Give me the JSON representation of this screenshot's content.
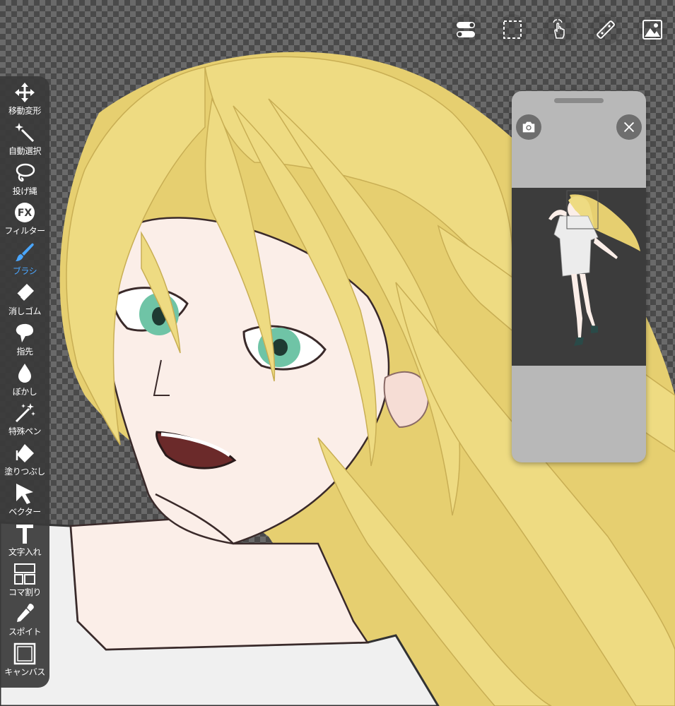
{
  "colors": {
    "accent": "#4aa6ff",
    "palette_bg": "#3a3a3a",
    "hair": "#ead67a",
    "skin": "#fbeee8",
    "eye": "#6fc4a6"
  },
  "top_toolbar": [
    {
      "id": "toggle",
      "icon": "toggle-switch-icon"
    },
    {
      "id": "selection",
      "icon": "dashed-selection-icon"
    },
    {
      "id": "touch",
      "icon": "touch-gesture-icon"
    },
    {
      "id": "ruler",
      "icon": "ruler-icon"
    },
    {
      "id": "layers",
      "icon": "image-layer-icon"
    }
  ],
  "tools": [
    {
      "id": "move",
      "label": "移動変形",
      "icon": "move-transform-icon"
    },
    {
      "id": "magic-wand",
      "label": "自動選択",
      "icon": "magic-wand-icon"
    },
    {
      "id": "lasso",
      "label": "投げ縄",
      "icon": "lasso-icon"
    },
    {
      "id": "filter",
      "label": "フィルター",
      "icon": "fx-filter-icon"
    },
    {
      "id": "brush",
      "label": "ブラシ",
      "icon": "brush-icon",
      "active": true
    },
    {
      "id": "eraser",
      "label": "消しゴム",
      "icon": "eraser-icon"
    },
    {
      "id": "smudge",
      "label": "指先",
      "icon": "smudge-icon"
    },
    {
      "id": "blur",
      "label": "ぼかし",
      "icon": "blur-drop-icon"
    },
    {
      "id": "special-pen",
      "label": "特殊ペン",
      "icon": "special-pen-icon"
    },
    {
      "id": "fill",
      "label": "塗りつぶし",
      "icon": "fill-bucket-icon"
    },
    {
      "id": "vector",
      "label": "ベクター",
      "icon": "vector-arrow-icon"
    },
    {
      "id": "text",
      "label": "文字入れ",
      "icon": "text-t-icon"
    },
    {
      "id": "frame",
      "label": "コマ割り",
      "icon": "frame-divide-icon"
    },
    {
      "id": "eyedropper",
      "label": "スポイト",
      "icon": "eyedropper-icon"
    },
    {
      "id": "canvas",
      "label": "キャンバス",
      "icon": "canvas-icon"
    }
  ],
  "navigator": {
    "camera_icon": "camera-icon",
    "close_icon": "close-icon"
  }
}
